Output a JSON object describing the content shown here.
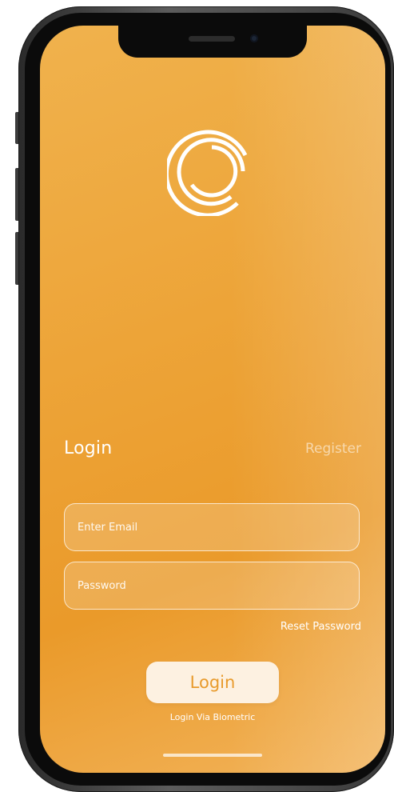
{
  "auth_tabs": {
    "login_label": "Login",
    "register_label": "Register"
  },
  "form": {
    "email_placeholder": "Enter Email",
    "email_value": "",
    "password_placeholder": "Password",
    "password_value": "",
    "reset_password_label": "Reset Password",
    "login_button_label": "Login",
    "biometric_label": "Login Via Biometric"
  },
  "icons": {
    "app_logo": "concentric-circle-logo-icon"
  },
  "colors": {
    "background_gradient_start": "#f0b24d",
    "background_gradient_end": "#ea9a2a",
    "button_background": "#fdf1e1",
    "button_text": "#e89a2b",
    "text_primary": "#ffffff"
  }
}
